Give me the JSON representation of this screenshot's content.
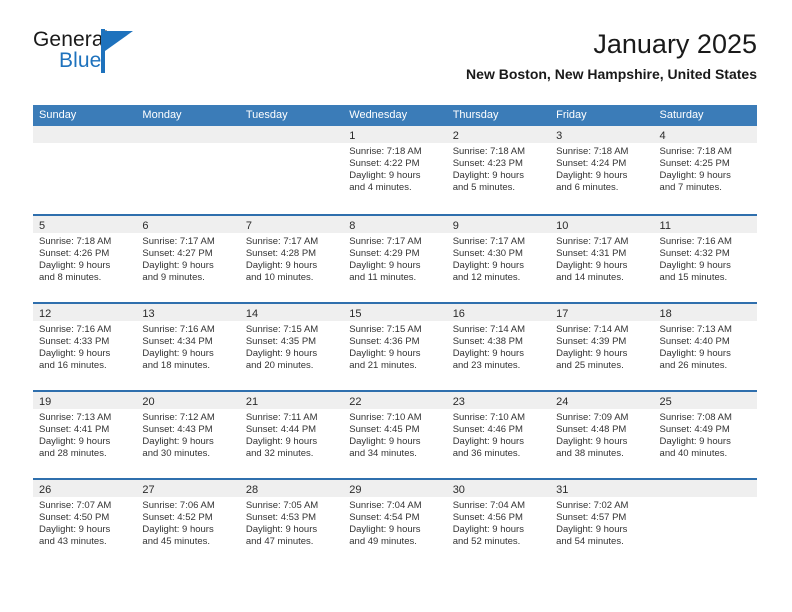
{
  "brand": {
    "name_part1": "General",
    "name_part2": "Blue"
  },
  "header": {
    "title": "January 2025",
    "subtitle": "New Boston, New Hampshire, United States"
  },
  "colors": {
    "header_blue": "#3b7cb8",
    "row_rule_blue": "#2f6fad",
    "day_band_gray": "#efefef",
    "brand_blue": "#1e72bd"
  },
  "weekdays": [
    "Sunday",
    "Monday",
    "Tuesday",
    "Wednesday",
    "Thursday",
    "Friday",
    "Saturday"
  ],
  "weeks": [
    [
      {
        "day": "",
        "sunrise": "",
        "sunset": "",
        "daylight1": "",
        "daylight2": ""
      },
      {
        "day": "",
        "sunrise": "",
        "sunset": "",
        "daylight1": "",
        "daylight2": ""
      },
      {
        "day": "",
        "sunrise": "",
        "sunset": "",
        "daylight1": "",
        "daylight2": ""
      },
      {
        "day": "1",
        "sunrise": "Sunrise: 7:18 AM",
        "sunset": "Sunset: 4:22 PM",
        "daylight1": "Daylight: 9 hours",
        "daylight2": "and 4 minutes."
      },
      {
        "day": "2",
        "sunrise": "Sunrise: 7:18 AM",
        "sunset": "Sunset: 4:23 PM",
        "daylight1": "Daylight: 9 hours",
        "daylight2": "and 5 minutes."
      },
      {
        "day": "3",
        "sunrise": "Sunrise: 7:18 AM",
        "sunset": "Sunset: 4:24 PM",
        "daylight1": "Daylight: 9 hours",
        "daylight2": "and 6 minutes."
      },
      {
        "day": "4",
        "sunrise": "Sunrise: 7:18 AM",
        "sunset": "Sunset: 4:25 PM",
        "daylight1": "Daylight: 9 hours",
        "daylight2": "and 7 minutes."
      }
    ],
    [
      {
        "day": "5",
        "sunrise": "Sunrise: 7:18 AM",
        "sunset": "Sunset: 4:26 PM",
        "daylight1": "Daylight: 9 hours",
        "daylight2": "and 8 minutes."
      },
      {
        "day": "6",
        "sunrise": "Sunrise: 7:17 AM",
        "sunset": "Sunset: 4:27 PM",
        "daylight1": "Daylight: 9 hours",
        "daylight2": "and 9 minutes."
      },
      {
        "day": "7",
        "sunrise": "Sunrise: 7:17 AM",
        "sunset": "Sunset: 4:28 PM",
        "daylight1": "Daylight: 9 hours",
        "daylight2": "and 10 minutes."
      },
      {
        "day": "8",
        "sunrise": "Sunrise: 7:17 AM",
        "sunset": "Sunset: 4:29 PM",
        "daylight1": "Daylight: 9 hours",
        "daylight2": "and 11 minutes."
      },
      {
        "day": "9",
        "sunrise": "Sunrise: 7:17 AM",
        "sunset": "Sunset: 4:30 PM",
        "daylight1": "Daylight: 9 hours",
        "daylight2": "and 12 minutes."
      },
      {
        "day": "10",
        "sunrise": "Sunrise: 7:17 AM",
        "sunset": "Sunset: 4:31 PM",
        "daylight1": "Daylight: 9 hours",
        "daylight2": "and 14 minutes."
      },
      {
        "day": "11",
        "sunrise": "Sunrise: 7:16 AM",
        "sunset": "Sunset: 4:32 PM",
        "daylight1": "Daylight: 9 hours",
        "daylight2": "and 15 minutes."
      }
    ],
    [
      {
        "day": "12",
        "sunrise": "Sunrise: 7:16 AM",
        "sunset": "Sunset: 4:33 PM",
        "daylight1": "Daylight: 9 hours",
        "daylight2": "and 16 minutes."
      },
      {
        "day": "13",
        "sunrise": "Sunrise: 7:16 AM",
        "sunset": "Sunset: 4:34 PM",
        "daylight1": "Daylight: 9 hours",
        "daylight2": "and 18 minutes."
      },
      {
        "day": "14",
        "sunrise": "Sunrise: 7:15 AM",
        "sunset": "Sunset: 4:35 PM",
        "daylight1": "Daylight: 9 hours",
        "daylight2": "and 20 minutes."
      },
      {
        "day": "15",
        "sunrise": "Sunrise: 7:15 AM",
        "sunset": "Sunset: 4:36 PM",
        "daylight1": "Daylight: 9 hours",
        "daylight2": "and 21 minutes."
      },
      {
        "day": "16",
        "sunrise": "Sunrise: 7:14 AM",
        "sunset": "Sunset: 4:38 PM",
        "daylight1": "Daylight: 9 hours",
        "daylight2": "and 23 minutes."
      },
      {
        "day": "17",
        "sunrise": "Sunrise: 7:14 AM",
        "sunset": "Sunset: 4:39 PM",
        "daylight1": "Daylight: 9 hours",
        "daylight2": "and 25 minutes."
      },
      {
        "day": "18",
        "sunrise": "Sunrise: 7:13 AM",
        "sunset": "Sunset: 4:40 PM",
        "daylight1": "Daylight: 9 hours",
        "daylight2": "and 26 minutes."
      }
    ],
    [
      {
        "day": "19",
        "sunrise": "Sunrise: 7:13 AM",
        "sunset": "Sunset: 4:41 PM",
        "daylight1": "Daylight: 9 hours",
        "daylight2": "and 28 minutes."
      },
      {
        "day": "20",
        "sunrise": "Sunrise: 7:12 AM",
        "sunset": "Sunset: 4:43 PM",
        "daylight1": "Daylight: 9 hours",
        "daylight2": "and 30 minutes."
      },
      {
        "day": "21",
        "sunrise": "Sunrise: 7:11 AM",
        "sunset": "Sunset: 4:44 PM",
        "daylight1": "Daylight: 9 hours",
        "daylight2": "and 32 minutes."
      },
      {
        "day": "22",
        "sunrise": "Sunrise: 7:10 AM",
        "sunset": "Sunset: 4:45 PM",
        "daylight1": "Daylight: 9 hours",
        "daylight2": "and 34 minutes."
      },
      {
        "day": "23",
        "sunrise": "Sunrise: 7:10 AM",
        "sunset": "Sunset: 4:46 PM",
        "daylight1": "Daylight: 9 hours",
        "daylight2": "and 36 minutes."
      },
      {
        "day": "24",
        "sunrise": "Sunrise: 7:09 AM",
        "sunset": "Sunset: 4:48 PM",
        "daylight1": "Daylight: 9 hours",
        "daylight2": "and 38 minutes."
      },
      {
        "day": "25",
        "sunrise": "Sunrise: 7:08 AM",
        "sunset": "Sunset: 4:49 PM",
        "daylight1": "Daylight: 9 hours",
        "daylight2": "and 40 minutes."
      }
    ],
    [
      {
        "day": "26",
        "sunrise": "Sunrise: 7:07 AM",
        "sunset": "Sunset: 4:50 PM",
        "daylight1": "Daylight: 9 hours",
        "daylight2": "and 43 minutes."
      },
      {
        "day": "27",
        "sunrise": "Sunrise: 7:06 AM",
        "sunset": "Sunset: 4:52 PM",
        "daylight1": "Daylight: 9 hours",
        "daylight2": "and 45 minutes."
      },
      {
        "day": "28",
        "sunrise": "Sunrise: 7:05 AM",
        "sunset": "Sunset: 4:53 PM",
        "daylight1": "Daylight: 9 hours",
        "daylight2": "and 47 minutes."
      },
      {
        "day": "29",
        "sunrise": "Sunrise: 7:04 AM",
        "sunset": "Sunset: 4:54 PM",
        "daylight1": "Daylight: 9 hours",
        "daylight2": "and 49 minutes."
      },
      {
        "day": "30",
        "sunrise": "Sunrise: 7:04 AM",
        "sunset": "Sunset: 4:56 PM",
        "daylight1": "Daylight: 9 hours",
        "daylight2": "and 52 minutes."
      },
      {
        "day": "31",
        "sunrise": "Sunrise: 7:02 AM",
        "sunset": "Sunset: 4:57 PM",
        "daylight1": "Daylight: 9 hours",
        "daylight2": "and 54 minutes."
      },
      {
        "day": "",
        "sunrise": "",
        "sunset": "",
        "daylight1": "",
        "daylight2": ""
      }
    ]
  ]
}
